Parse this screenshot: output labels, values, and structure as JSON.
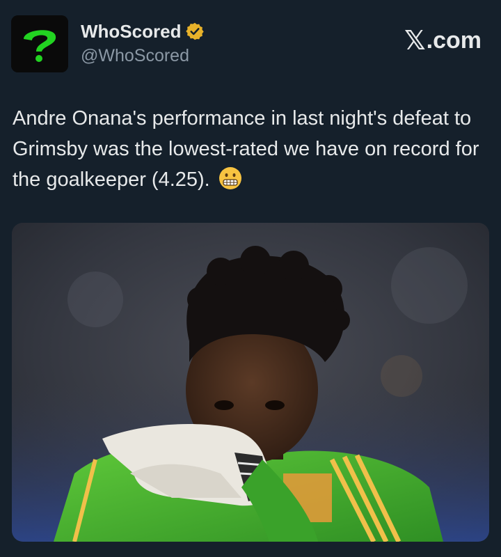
{
  "account": {
    "display_name": "WhoScored",
    "handle": "@WhoScored",
    "verified": true,
    "avatar_icon": "whoscored-question-mark-logo",
    "brand_color": "#22d321"
  },
  "source": {
    "label": ".com",
    "icon": "x-logo-icon"
  },
  "tweet": {
    "text": "Andre Onana's performance in last night's defeat to Grimsby was the lowest-rated we have on record for the goalkeeper (4.25).",
    "emoji": "grimacing-face"
  },
  "media": {
    "type": "photo",
    "icon": "goalkeeper-photo"
  },
  "colors": {
    "background": "#15202b",
    "text": "#e7e9ea",
    "secondary_text": "#8b98a5",
    "verified_badge": "#e8b22a"
  }
}
